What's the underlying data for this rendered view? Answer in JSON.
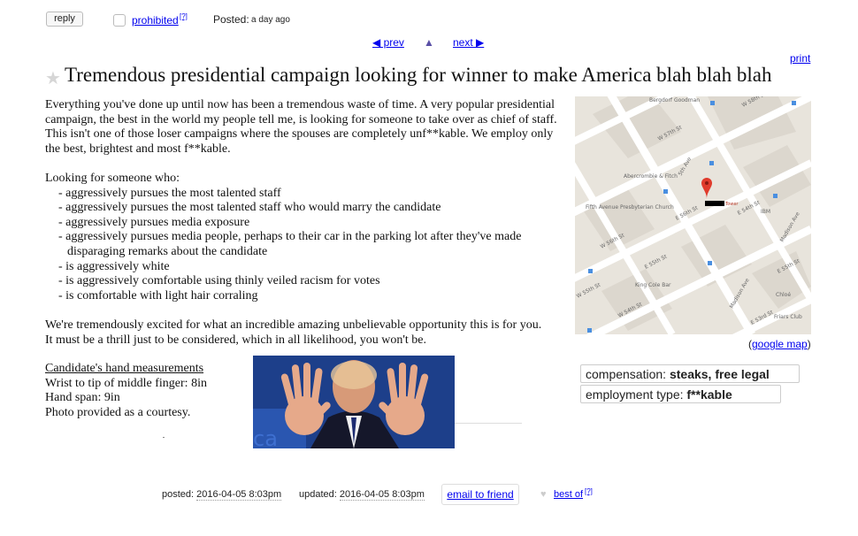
{
  "topbar": {
    "reply_label": "reply",
    "prohibited_label": "prohibited",
    "prohibited_help": "[?]",
    "posted_label": "Posted:",
    "posted_value": "a day ago"
  },
  "nav": {
    "prev_label": "◀ prev",
    "up_label": "▲",
    "next_label": "next ▶",
    "print_label": "print"
  },
  "post": {
    "star_glyph": "★",
    "title": "Tremendous presidential campaign looking for winner to make America blah blah blah",
    "intro": "Everything you've done up until now has been a tremendous waste of time. A very popular presidential campaign, the best in the world my people tell me, is looking for someone to take over as chief of staff. This isn't one of those loser campaigns where the spouses are completely unf**kable. We employ only the best, brightest and most f**kable.",
    "looking_for": "Looking for someone who:",
    "requirements": [
      "- aggressively pursues the most talented staff",
      "- aggressively pursues the most talented staff who would marry the candidate",
      "- aggressively pursues media exposure",
      "- aggressively pursues media people, perhaps to their car in the parking lot after they've made disparaging remarks about the candidate",
      "- is aggressively white",
      "- is aggressively comfortable using thinly veiled racism for votes",
      "- is comfortable with light hair corraling"
    ],
    "closing": "We're tremendously excited for what an incredible amazing unbelievable opportunity this is for you. It must be a thrill just to be considered, which in all likelihood, you won't be.",
    "measurements_heading": "Candidate's hand measurements",
    "measurements": [
      "Wrist to tip of middle finger: 8in",
      "Hand span: 9in",
      "Photo provided as a courtesy."
    ]
  },
  "map": {
    "google_map_link": "google map",
    "paren_open": "(",
    "paren_close": ")",
    "labels": {
      "bergdorf": "Bergdorf Goodman",
      "w57": "W 57th St",
      "w58": "W 58th St",
      "abercrombie": "Abercrombie & Fitch",
      "fifth_ave_church": "Fifth Avenue Presbyterian Church",
      "fifth_ave": "5th Ave",
      "e56": "E 56th St",
      "tower": "Tower",
      "ibm": "IBM",
      "madison": "Madison Ave",
      "w56": "W 56th St",
      "e55": "E 55th St",
      "king_cole": "King Cole Bar",
      "w55": "W 55th St",
      "w54": "W 54th St",
      "e54": "E 54th St",
      "chloe": "Chloé",
      "friars": "Friars Club",
      "e53": "E 53rd St"
    }
  },
  "attributes": {
    "compensation_label": "compensation:",
    "compensation_value": "steaks, free legal counsel",
    "employment_label": "employment type:",
    "employment_value": "f**kable"
  },
  "footer": {
    "posted_label": "posted:",
    "posted_value": "2016-04-05 8:03pm",
    "updated_label": "updated:",
    "updated_value": "2016-04-05 8:03pm",
    "email_label": "email to friend",
    "heart_glyph": "♥",
    "best_of_label": "best of",
    "best_of_help": "[?]"
  },
  "colors": {
    "link": "#0000ee",
    "map_bg": "#e8e4dc",
    "map_road": "#ffffff",
    "map_pin": "#e03b2c",
    "photo_bg": "#1d3f8a"
  }
}
